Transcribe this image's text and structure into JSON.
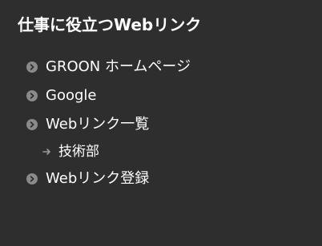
{
  "panel": {
    "title": "仕事に役立つWebリンク"
  },
  "links": [
    {
      "label": "GROON ホームページ"
    },
    {
      "label": "Google"
    },
    {
      "label": "Webリンク一覧"
    },
    {
      "label": "Webリンク登録"
    }
  ],
  "sublinks": [
    {
      "label": "技術部"
    }
  ],
  "colors": {
    "background": "#2e2e2e",
    "text": "#ffffff",
    "bullet": "#8a8a8a"
  },
  "icons": {
    "bullet": "circle-chevron-right-icon",
    "sub_arrow": "arrow-right-icon"
  }
}
